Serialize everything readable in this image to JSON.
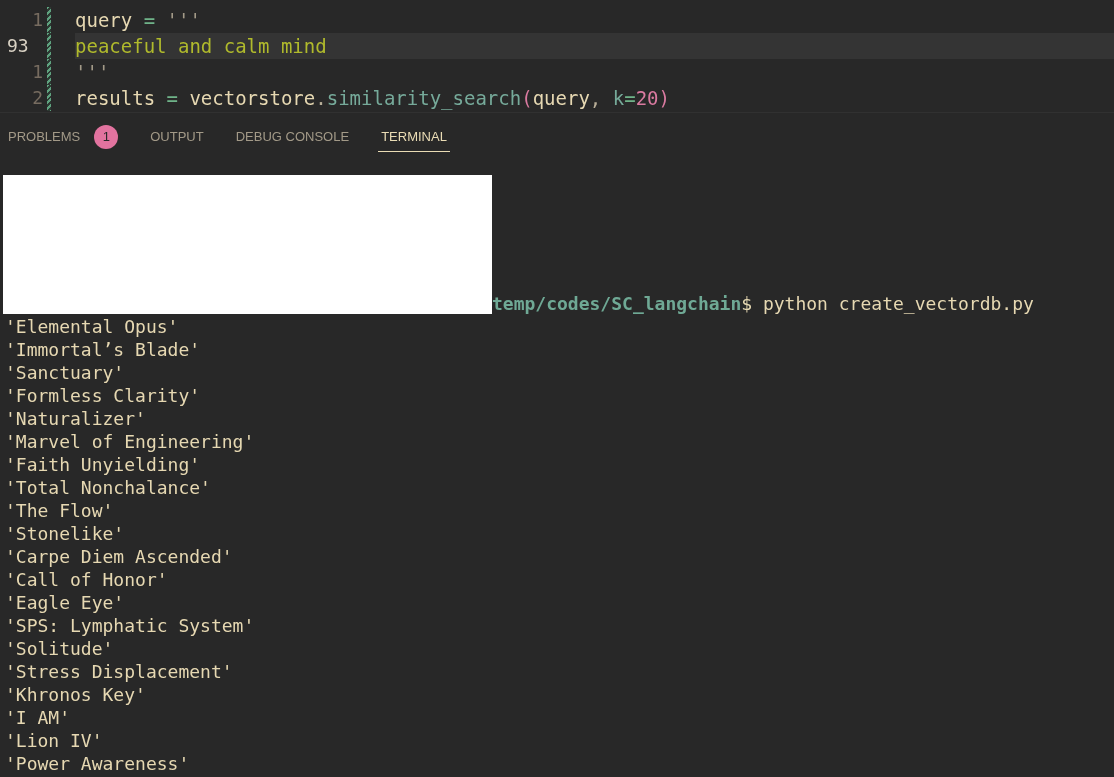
{
  "editor": {
    "lines": [
      {
        "number": "1",
        "current": false,
        "modified": true,
        "tokens": [
          {
            "kind": "name",
            "text": "query"
          },
          {
            "kind": "operator",
            "text": " = "
          },
          {
            "kind": "string_delimiter",
            "text": "'''"
          }
        ]
      },
      {
        "number": "93",
        "current": true,
        "modified": true,
        "tokens": [
          {
            "kind": "string",
            "text": "peaceful and calm mind"
          }
        ]
      },
      {
        "number": "1",
        "current": false,
        "modified": true,
        "tokens": [
          {
            "kind": "string_delimiter",
            "text": "'''"
          }
        ]
      },
      {
        "number": "2",
        "current": false,
        "modified": true,
        "tokens": [
          {
            "kind": "name",
            "text": "results"
          },
          {
            "kind": "operator",
            "text": " = "
          },
          {
            "kind": "name",
            "text": "vectorstore"
          },
          {
            "kind": "punctuation",
            "text": "."
          },
          {
            "kind": "function",
            "text": "similarity_search"
          },
          {
            "kind": "bracket",
            "text": "("
          },
          {
            "kind": "name",
            "text": "query"
          },
          {
            "kind": "punctuation",
            "text": ", "
          },
          {
            "kind": "parameter",
            "text": "k"
          },
          {
            "kind": "operator",
            "text": "="
          },
          {
            "kind": "number",
            "text": "20"
          },
          {
            "kind": "bracket",
            "text": ")"
          }
        ]
      }
    ]
  },
  "panel": {
    "tabs": [
      {
        "label": "PROBLEMS",
        "selected": false,
        "badge": "1"
      },
      {
        "label": "OUTPUT",
        "selected": false
      },
      {
        "label": "DEBUG CONSOLE",
        "selected": false
      },
      {
        "label": "TERMINAL",
        "selected": true
      }
    ]
  },
  "terminal": {
    "prompt": {
      "path": "temp/codes/SC_langchain",
      "symbol": "$",
      "command": "python create_vectordb.py"
    },
    "output": [
      "'Elemental Opus'",
      "'Immortal’s Blade'",
      "'Sanctuary'",
      "'Formless Clarity'",
      "'Naturalizer'",
      "'Marvel of Engineering'",
      "'Faith Unyielding'",
      "'Total Nonchalance'",
      "'The Flow'",
      "'Stonelike'",
      "'Carpe Diem Ascended'",
      "'Call of Honor'",
      "'Eagle Eye'",
      "'SPS: Lymphatic System'",
      "'Solitude'",
      "'Stress Displacement'",
      "'Khronos Key'",
      "'I AM'",
      "'Lion IV'",
      "'Power Awareness'"
    ]
  }
}
